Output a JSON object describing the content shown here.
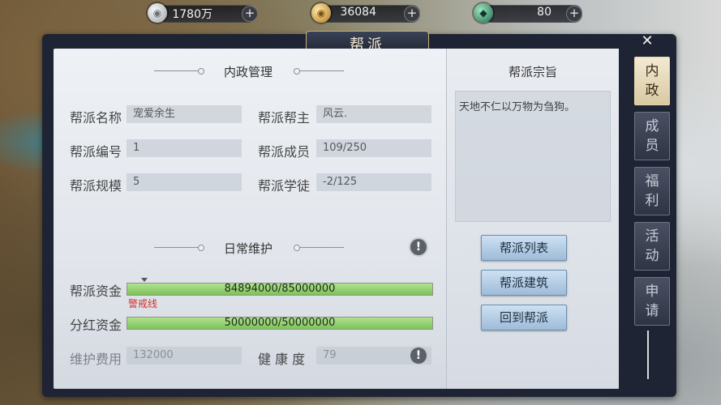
{
  "currencies": [
    {
      "icon": "silver-coin-icon",
      "value": "1780万",
      "color": "#cfd3d8"
    },
    {
      "icon": "gold-coin-icon",
      "value": "36084",
      "color": "#d6a64a"
    },
    {
      "icon": "jade-gem-icon",
      "value": "80",
      "color": "#3f9a72"
    }
  ],
  "window": {
    "title": "帮派",
    "close_symbol": "✕"
  },
  "internal": {
    "heading": "内政管理",
    "rows": [
      {
        "label": "帮派名称",
        "value": "宠爱余生",
        "label2": "帮派帮主",
        "value2": "风云."
      },
      {
        "label": "帮派编号",
        "value": "1",
        "label2": "帮派成员",
        "value2": "109/250"
      },
      {
        "label": "帮派规模",
        "value": "5",
        "label2": "帮派学徒",
        "value2": "-2/125"
      }
    ]
  },
  "maintenance": {
    "heading": "日常维护",
    "info_symbol": "!",
    "fund_label": "帮派资金",
    "fund_text": "84894000/85000000",
    "fund_ratio": 0.99875,
    "warning_label": "警戒线",
    "dividend_label": "分红资金",
    "dividend_text": "50000000/50000000",
    "dividend_ratio": 1.0,
    "upkeep_label": "维护费用",
    "upkeep_value": "132000",
    "health_label": "健 康 度",
    "health_value": "79"
  },
  "motto": {
    "heading": "帮派宗旨",
    "text": "天地不仁以万物为刍狗。"
  },
  "buttons": {
    "list": "帮派列表",
    "build": "帮派建筑",
    "return": "回到帮派"
  },
  "tabs": [
    {
      "c1": "内",
      "c2": "政",
      "active": true
    },
    {
      "c1": "成",
      "c2": "员",
      "active": false
    },
    {
      "c1": "福",
      "c2": "利",
      "active": false
    },
    {
      "c1": "活",
      "c2": "动",
      "active": false
    },
    {
      "c1": "申",
      "c2": "请",
      "active": false
    }
  ],
  "colors": {
    "bar_fill": "#8fd06b",
    "warning": "#d0312d",
    "active_tab": "#e8dcbc"
  }
}
